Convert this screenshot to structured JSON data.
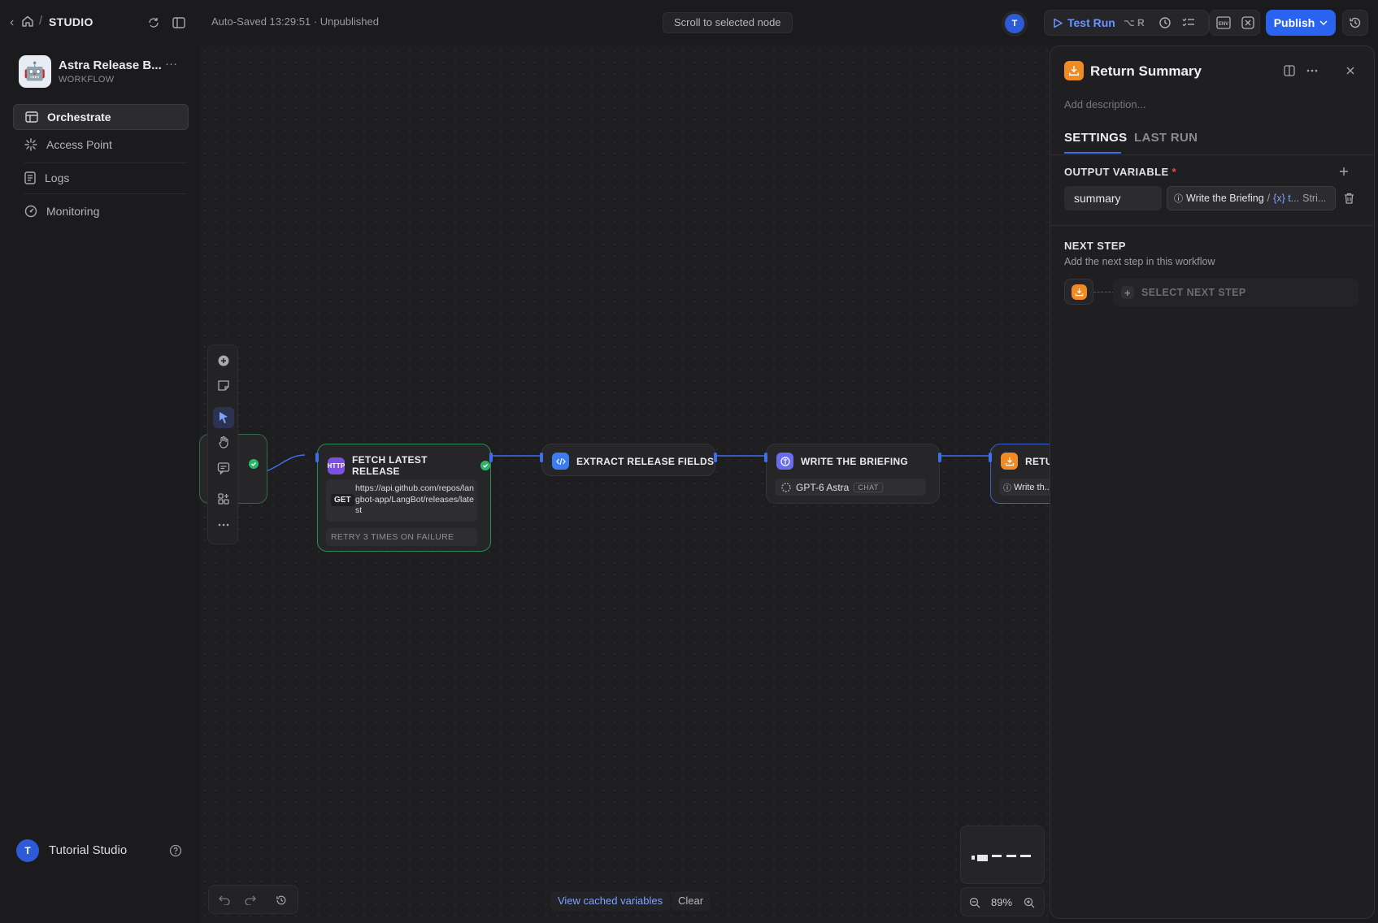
{
  "topbar": {
    "breadcrumb": "STUDIO",
    "autosave": "Auto-Saved 13:29:51 · Unpublished",
    "scroll_button": "Scroll to selected node",
    "avatar_initial": "T",
    "test_run_label": "Test Run",
    "test_run_shortcut": "⌥ R",
    "publish_label": "Publish"
  },
  "app": {
    "name": "Astra Release B...",
    "type": "WORKFLOW"
  },
  "sidebar": {
    "items": [
      {
        "label": "Orchestrate",
        "icon": "orchestrate-icon",
        "active": true
      },
      {
        "label": "Access Point",
        "icon": "access-point-icon",
        "active": false
      },
      {
        "label": "Logs",
        "icon": "logs-icon",
        "active": false
      },
      {
        "label": "Monitoring",
        "icon": "monitoring-icon",
        "active": false
      }
    ],
    "user_initial": "T",
    "user_name": "Tutorial Studio"
  },
  "canvas": {
    "nodes": {
      "fetch": {
        "title": "FETCH LATEST RELEASE",
        "icon_text": "HTTP",
        "method": "GET",
        "url": "https://api.github.com/repos/langbot-app/LangBot/releases/latest",
        "retry": "RETRY 3 TIMES ON FAILURE"
      },
      "extract": {
        "title": "EXTRACT RELEASE FIELDS"
      },
      "write": {
        "title": "WRITE THE BRIEFING",
        "model": "GPT-6 Astra",
        "model_mode": "CHAT"
      },
      "return": {
        "title": "RETUR",
        "ref": "Write th..."
      }
    },
    "view_cached": "View cached variables",
    "clear": "Clear",
    "zoom": "89%"
  },
  "panel": {
    "title": "Return Summary",
    "description_placeholder": "Add description...",
    "tabs": [
      "SETTINGS",
      "LAST RUN"
    ],
    "output_variable_title": "OUTPUT VARIABLE",
    "required_mark": "*",
    "variable_name": "summary",
    "variable_source_node": "Write the Briefing",
    "variable_separator": "/",
    "variable_source_var": "{x} t...",
    "variable_type": "Stri...",
    "next_step_title": "NEXT STEP",
    "next_step_subtitle": "Add the next step in this workflow",
    "select_next_step": "SELECT NEXT STEP"
  },
  "colors": {
    "accent": "#2a63f0",
    "return_node": "#f08a24",
    "http_node": "#7b4fe0",
    "code_node": "#3b7cf0",
    "llm_node": "#6a6cf0",
    "success": "#2fb36b"
  }
}
